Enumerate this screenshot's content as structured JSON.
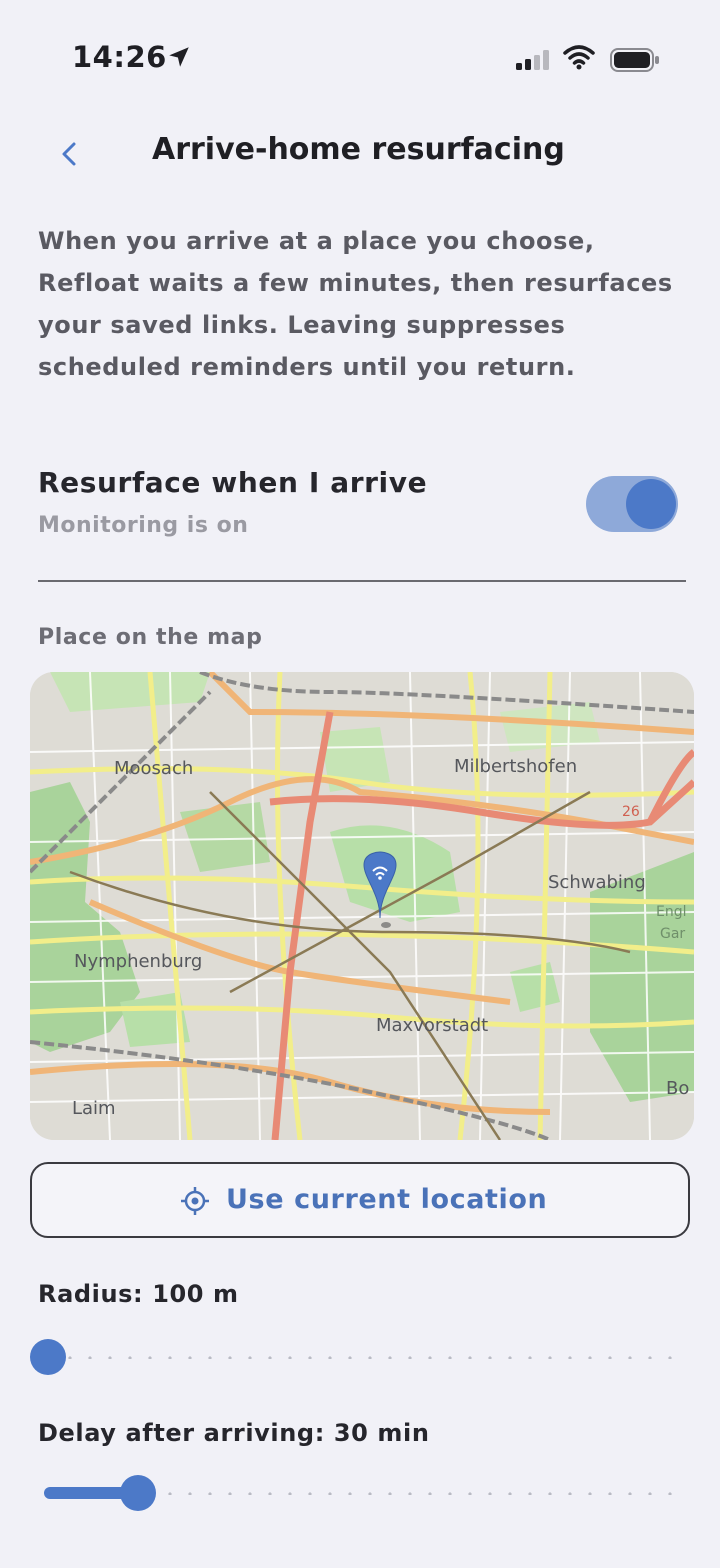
{
  "status_bar": {
    "time": "14:26"
  },
  "nav": {
    "title": "Arrive-home resurfacing"
  },
  "description": "When you arrive at a place you choose, Refloat waits a few minutes, then resurfaces your saved links. Leaving suppresses scheduled reminders until you return.",
  "toggle": {
    "title": "Resurface when I arrive",
    "subtitle": "Monitoring is on",
    "on": true
  },
  "map_section": {
    "label": "Place on the map",
    "place_labels": [
      "Moosach",
      "Milbertshofen",
      "Schwabing",
      "Nymphenburg",
      "Maxvorstadt",
      "Laim",
      "26",
      "Engl",
      "Gar",
      "Bo"
    ]
  },
  "location_button": {
    "label": "Use current location"
  },
  "radius": {
    "label": "Radius: 100 m",
    "fraction": 0.0
  },
  "delay": {
    "label": "Delay after arriving: 30 min",
    "fraction": 0.15
  },
  "colors": {
    "accent": "#4c79c8",
    "background": "#f1f1f7",
    "text_secondary": "#5a5a62"
  }
}
